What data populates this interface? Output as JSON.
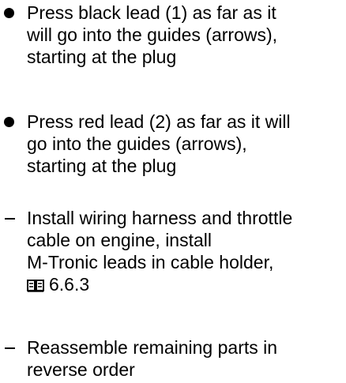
{
  "instructions": [
    {
      "marker": "bullet",
      "lines": [
        "Press black lead (1) as far as it",
        "will go into the guides (arrows),",
        "starting at the plug"
      ]
    },
    {
      "marker": "bullet",
      "lines": [
        "Press red lead (2) as far as it will",
        "go into the guides (arrows),",
        "starting at the plug"
      ]
    },
    {
      "marker": "dash",
      "lines": [
        "Install wiring harness and throttle",
        "cable on engine, install",
        "M-Tronic leads in cable holder,"
      ],
      "reference": {
        "icon": "manual-book-icon",
        "section": "6.6.3"
      }
    },
    {
      "marker": "dash",
      "lines": [
        "Reassemble remaining parts in",
        "reverse order"
      ]
    }
  ]
}
